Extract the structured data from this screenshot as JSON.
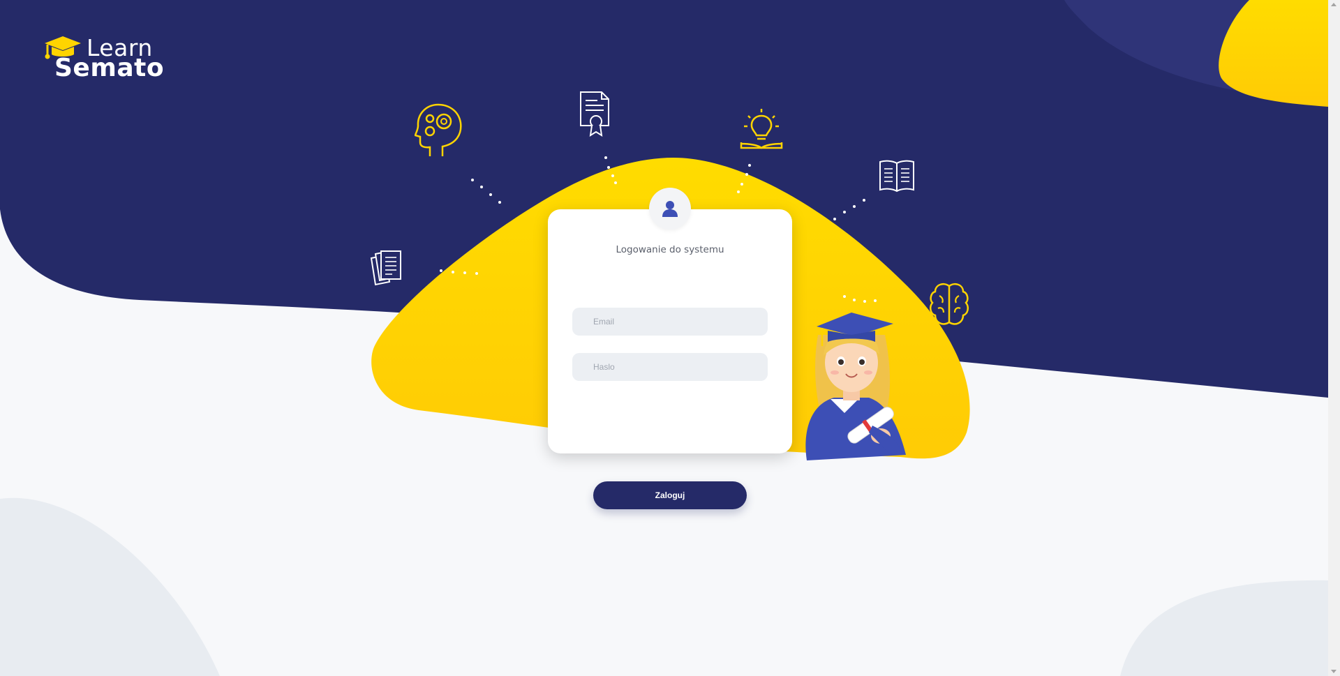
{
  "app": {
    "brand_line1": "Learn",
    "brand_line2": "Semato"
  },
  "login": {
    "title": "Logowanie do systemu",
    "email_placeholder": "Email",
    "password_placeholder": "Haslo",
    "submit_label": "Zaloguj"
  },
  "colors": {
    "navy": "#252a68",
    "yellow": "#ffd800",
    "background": "#f7f8fa",
    "card": "#ffffff",
    "field": "#eceff3"
  },
  "icons": {
    "logo": "graduation-cap-icon",
    "user": "user-icon",
    "head_gears": "head-gears-icon",
    "certificate": "certificate-icon",
    "lightbulb": "lightbulb-book-icon",
    "book": "open-book-icon",
    "documents": "documents-icon",
    "brain": "brain-icon",
    "illustration": "graduate-girl-illustration"
  }
}
